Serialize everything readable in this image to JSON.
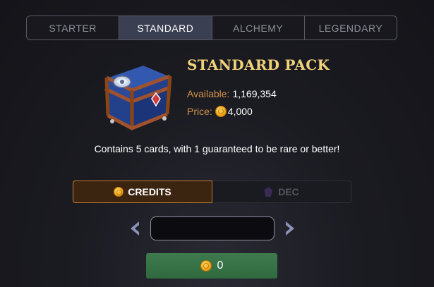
{
  "tabs": [
    {
      "label": "STARTER",
      "active": false
    },
    {
      "label": "STANDARD",
      "active": true
    },
    {
      "label": "ALCHEMY",
      "active": false
    },
    {
      "label": "LEGENDARY",
      "active": false
    }
  ],
  "pack": {
    "image_icon": "treasure-chest-icon",
    "title": "STANDARD PACK",
    "available_label": "Available:",
    "available_value": "1,169,354",
    "price_label": "Price:",
    "price_value": "4,000",
    "description": "Contains 5 cards, with 1 guaranteed to be rare or better!"
  },
  "currency": {
    "credits_label": "CREDITS",
    "dec_label": "DEC",
    "selected": "CREDITS"
  },
  "quantity": {
    "value": ""
  },
  "buy": {
    "value": "0"
  },
  "colors": {
    "title": "#f0d27a",
    "label": "#d4954a",
    "active_tab": "#3a3f52",
    "buy_button": "#36704a",
    "credits_border": "#c27a30"
  }
}
